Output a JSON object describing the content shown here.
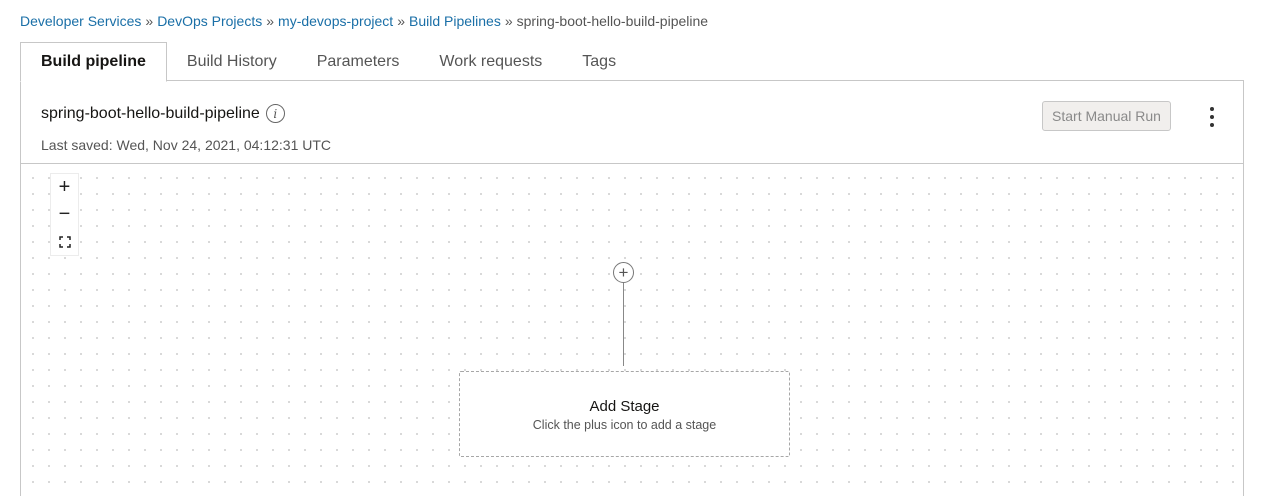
{
  "breadcrumb": {
    "items": [
      "Developer Services",
      "DevOps Projects",
      "my-devops-project",
      "Build Pipelines"
    ],
    "separator": "»",
    "current": "spring-boot-hello-build-pipeline"
  },
  "tabs": [
    {
      "label": "Build pipeline",
      "active": true
    },
    {
      "label": "Build History",
      "active": false
    },
    {
      "label": "Parameters",
      "active": false
    },
    {
      "label": "Work requests",
      "active": false
    },
    {
      "label": "Tags",
      "active": false
    }
  ],
  "pipeline": {
    "name": "spring-boot-hello-build-pipeline",
    "info_icon": "info-icon",
    "last_saved": "Last saved: Wed, Nov 24, 2021, 04:12:31 UTC",
    "run_button": "Start Manual Run",
    "actions_icon": "kebab-icon"
  },
  "zoom": {
    "zoom_in": "+",
    "zoom_out": "−",
    "fit": "⛶"
  },
  "stage": {
    "add_icon": "+",
    "title": "Add Stage",
    "subtitle": "Click the plus icon to add a stage"
  },
  "colors": {
    "link": "#1a6fa7",
    "border": "#c7c7c7",
    "disabled_button_bg": "#f1efed"
  }
}
